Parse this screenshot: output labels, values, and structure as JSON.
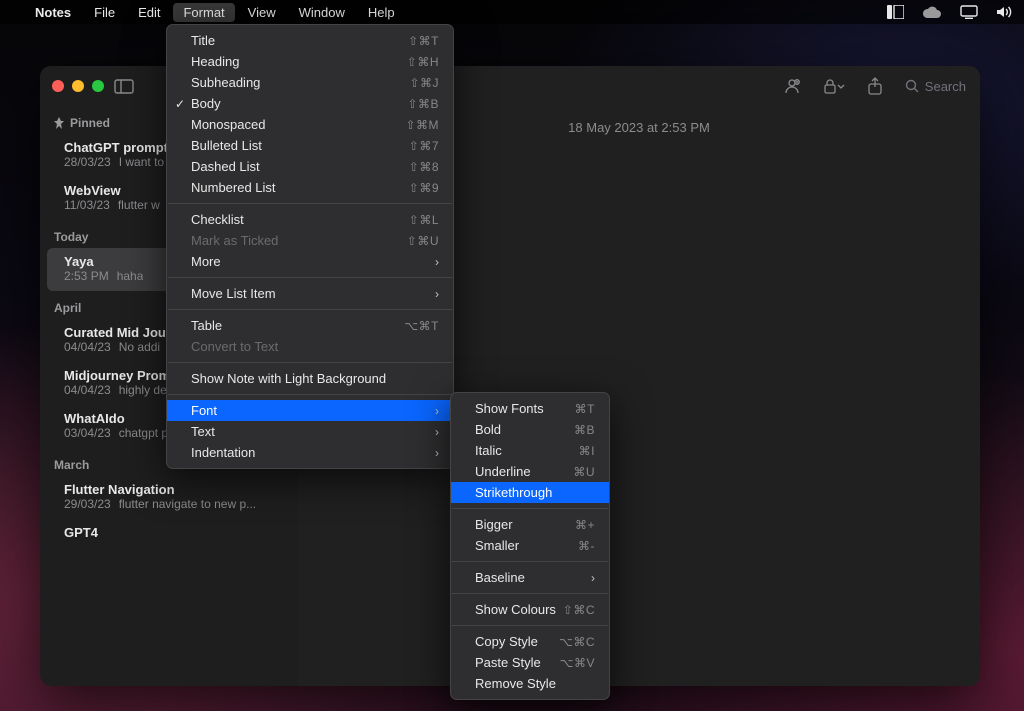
{
  "menubar": {
    "app": "Notes",
    "items": [
      "File",
      "Edit",
      "Format",
      "View",
      "Window",
      "Help"
    ],
    "active_index": 2
  },
  "traffic_colors": {
    "close": "#ff5f57",
    "min": "#febc2e",
    "max": "#28c840"
  },
  "toolbar": {
    "search_placeholder": "Search"
  },
  "note_view": {
    "timestamp": "18 May 2023 at 2:53 PM"
  },
  "sidebar": {
    "pinned_label": "Pinned",
    "groups": [
      {
        "header": "Pinned",
        "pinned": true,
        "items": [
          {
            "title": "ChatGPT prompt",
            "date": "28/03/23",
            "preview": "I want to"
          },
          {
            "title": "WebView",
            "date": "11/03/23",
            "preview": "flutter w"
          }
        ]
      },
      {
        "header": "Today",
        "items": [
          {
            "title": "Yaya",
            "date": "2:53 PM",
            "preview": "haha",
            "selected": true
          }
        ]
      },
      {
        "header": "April",
        "items": [
          {
            "title": "Curated Mid Jou",
            "date": "04/04/23",
            "preview": "No addi"
          },
          {
            "title": "Midjourney Prompts",
            "date": "04/04/23",
            "preview": "highly detailed photogra..."
          },
          {
            "title": "WhatAIdo",
            "date": "03/04/23",
            "preview": "chatgpt prompt generator"
          }
        ]
      },
      {
        "header": "March",
        "items": [
          {
            "title": "Flutter Navigation",
            "date": "29/03/23",
            "preview": "flutter navigate to new p..."
          },
          {
            "title": "GPT4",
            "date": "",
            "preview": ""
          }
        ]
      }
    ]
  },
  "format_menu": [
    {
      "label": "Title",
      "shortcut": "⇧⌘T"
    },
    {
      "label": "Heading",
      "shortcut": "⇧⌘H"
    },
    {
      "label": "Subheading",
      "shortcut": "⇧⌘J"
    },
    {
      "label": "Body",
      "shortcut": "⇧⌘B",
      "checked": true
    },
    {
      "label": "Monospaced",
      "shortcut": "⇧⌘M"
    },
    {
      "label": "Bulleted List",
      "shortcut": "⇧⌘7"
    },
    {
      "label": "Dashed List",
      "shortcut": "⇧⌘8"
    },
    {
      "label": "Numbered List",
      "shortcut": "⇧⌘9"
    },
    {
      "sep": true
    },
    {
      "label": "Checklist",
      "shortcut": "⇧⌘L"
    },
    {
      "label": "Mark as Ticked",
      "shortcut": "⇧⌘U",
      "disabled": true
    },
    {
      "label": "More",
      "submenu": true
    },
    {
      "sep": true
    },
    {
      "label": "Move List Item",
      "submenu": true
    },
    {
      "sep": true
    },
    {
      "label": "Table",
      "shortcut": "⌥⌘T"
    },
    {
      "label": "Convert to Text",
      "disabled": true
    },
    {
      "sep": true
    },
    {
      "label": "Show Note with Light Background"
    },
    {
      "sep": true
    },
    {
      "label": "Font",
      "submenu": true,
      "highlight": true
    },
    {
      "label": "Text",
      "submenu": true
    },
    {
      "label": "Indentation",
      "submenu": true
    }
  ],
  "font_menu": [
    {
      "label": "Show Fonts",
      "shortcut": "⌘T"
    },
    {
      "label": "Bold",
      "shortcut": "⌘B"
    },
    {
      "label": "Italic",
      "shortcut": "⌘I"
    },
    {
      "label": "Underline",
      "shortcut": "⌘U"
    },
    {
      "label": "Strikethrough",
      "highlight": true
    },
    {
      "sep": true
    },
    {
      "label": "Bigger",
      "shortcut": "⌘+"
    },
    {
      "label": "Smaller",
      "shortcut": "⌘-"
    },
    {
      "sep": true
    },
    {
      "label": "Baseline",
      "submenu": true
    },
    {
      "sep": true
    },
    {
      "label": "Show Colours",
      "shortcut": "⇧⌘C"
    },
    {
      "sep": true
    },
    {
      "label": "Copy Style",
      "shortcut": "⌥⌘C"
    },
    {
      "label": "Paste Style",
      "shortcut": "⌥⌘V"
    },
    {
      "label": "Remove Style"
    }
  ]
}
